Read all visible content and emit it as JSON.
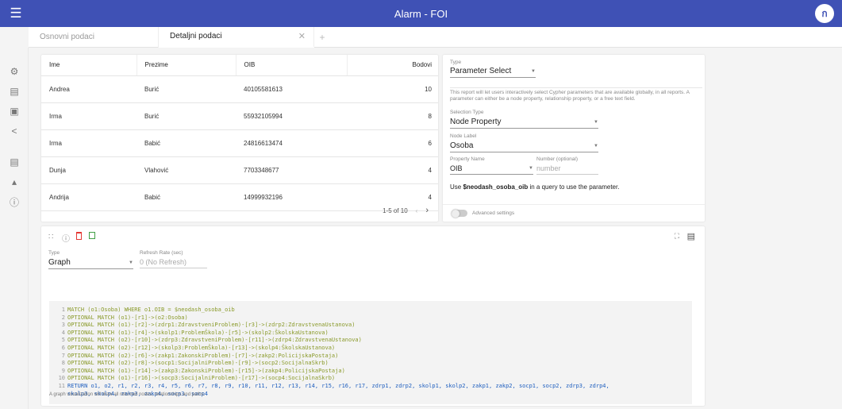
{
  "app": {
    "title": "Alarm - FOI",
    "connection_icon": "neo4j-connection-icon",
    "accent": "#3f51b5"
  },
  "tabs": [
    {
      "label": "Osnovni podaci",
      "active": false
    },
    {
      "label": "Detaljni podaci",
      "active": true
    }
  ],
  "sidebar": [
    "gear-icon",
    "save-icon",
    "load-icon",
    "share-icon",
    "library-icon",
    "extensions-icon",
    "info-icon"
  ],
  "table": {
    "headers": [
      "Ime",
      "Prezime",
      "OIB",
      "Bodovi"
    ],
    "rows": [
      [
        "Andrea",
        "Burić",
        "40105581613",
        "10"
      ],
      [
        "Irma",
        "Burić",
        "55932105994",
        "8"
      ],
      [
        "Irma",
        "Babić",
        "24816613474",
        "6"
      ],
      [
        "Dunja",
        "Vlahović",
        "7703348677",
        "4"
      ],
      [
        "Andrija",
        "Babić",
        "14999932196",
        "4"
      ]
    ],
    "pager": "1-5 of 10"
  },
  "param": {
    "type_label": "Type",
    "type_value": "Parameter Select",
    "help": "This report will let users interactively select Cypher parameters that are available globally, in all reports. A parameter can either be a node property, relationship property, or a free text field.",
    "selection_label": "Selection Type",
    "selection_value": "Node Property",
    "node_label_label": "Node Label",
    "node_label_value": "Osoba",
    "property_label": "Property Name",
    "property_value": "OIB",
    "number_label": "Number (optional)",
    "number_placeholder": "number",
    "usage_pre": "Use ",
    "usage_param": "$neodash_osoba_oib",
    "usage_post": " in a query to use the parameter.",
    "advanced": "Advanced settings"
  },
  "graph": {
    "type_label": "Type",
    "type_value": "Graph",
    "refresh_label": "Refresh Rate (sec)",
    "refresh_value": "0 (No Refresh)",
    "query": [
      "MATCH (o1:Osoba) WHERE o1.OIB = $neodash_osoba_oib",
      "OPTIONAL MATCH (o1)-[r1]->(o2:Osoba)",
      "OPTIONAL MATCH (o1)-[r2]->(zdrp1:ZdravstveniProblem)-[r3]->(zdrp2:ZdravstvenaUstanova)",
      "OPTIONAL MATCH (o1)-[r4]->(skolp1:ProblemŠkola)-[r5]->(skolp2:ŠkolskaUstanova)",
      "OPTIONAL MATCH (o2)-[r10]->(zdrp3:ZdravstveniProblem)-[r11]->(zdrp4:ZdravstvenaUstanova)",
      "OPTIONAL MATCH (o2)-[r12]->(skolp3:ProblemŠkola)-[r13]->(skolp4:ŠkolskaUstanova)",
      "OPTIONAL MATCH (o2)-[r6]->(zakp1:ZakonskiProblem)-[r7]->(zakp2:PolicijskaPostaja)",
      "OPTIONAL MATCH (o2)-[r8]->(socp1:SocijalniProblem)-[r9]->(socp2:SocijalnaSkrb)",
      "OPTIONAL MATCH (o1)-[r14]->(zakp3:ZakonskiProblem)-[r15]->(zakp4:PolicijskaPostaja)",
      "OPTIONAL MATCH (o1)-[r16]->(socp3:SocijalniProblem)-[r17]->(socp4:SocijalnaSkrb)",
      "RETURN o1, o2, r1, r2, r3, r4, r5, r6, r7, r8, r9, r10, r11, r12, r13, r14, r15, r16, r17, zdrp1, zdrp2, skolp1, skolp2, zakp1, zakp2, socp1, socp2, zdrp3, zdrp4,",
      "skolp3, skolp4, zakp3, zakp4, socp3, socp4"
    ],
    "footer": "A graph visualization will draw all returned nodes, relationships and paths."
  }
}
